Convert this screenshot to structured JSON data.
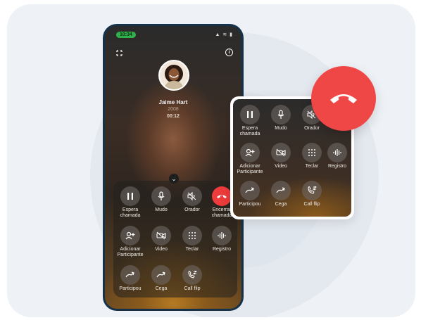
{
  "status": {
    "time": "10:34",
    "signal_icons": "▲ ≋ ▮"
  },
  "caller": {
    "name": "Jaime Hart",
    "extension": "2008",
    "duration": "00:12"
  },
  "controls": [
    {
      "label": "Espera\nchamada",
      "icon": "pause-icon"
    },
    {
      "label": "Mudo",
      "icon": "microphone-icon"
    },
    {
      "label": "Orador",
      "icon": "speaker-off-icon"
    },
    {
      "label": "Encerrar\nchamada",
      "icon": "hang-up-icon"
    },
    {
      "label": "Adicionar\nParticipante",
      "icon": "add-participant-icon"
    },
    {
      "label": "Video",
      "icon": "video-off-icon"
    },
    {
      "label": "Teclar",
      "icon": "keypad-icon"
    },
    {
      "label": "Registro",
      "icon": "waveform-icon"
    },
    {
      "label": "Participou",
      "icon": "transfer-icon"
    },
    {
      "label": "Cega",
      "icon": "blind-transfer-icon"
    },
    {
      "label": "Call flip",
      "icon": "call-flip-icon"
    }
  ],
  "colors": {
    "end_call": "#ef4646",
    "status_pill": "#2fb24c"
  }
}
